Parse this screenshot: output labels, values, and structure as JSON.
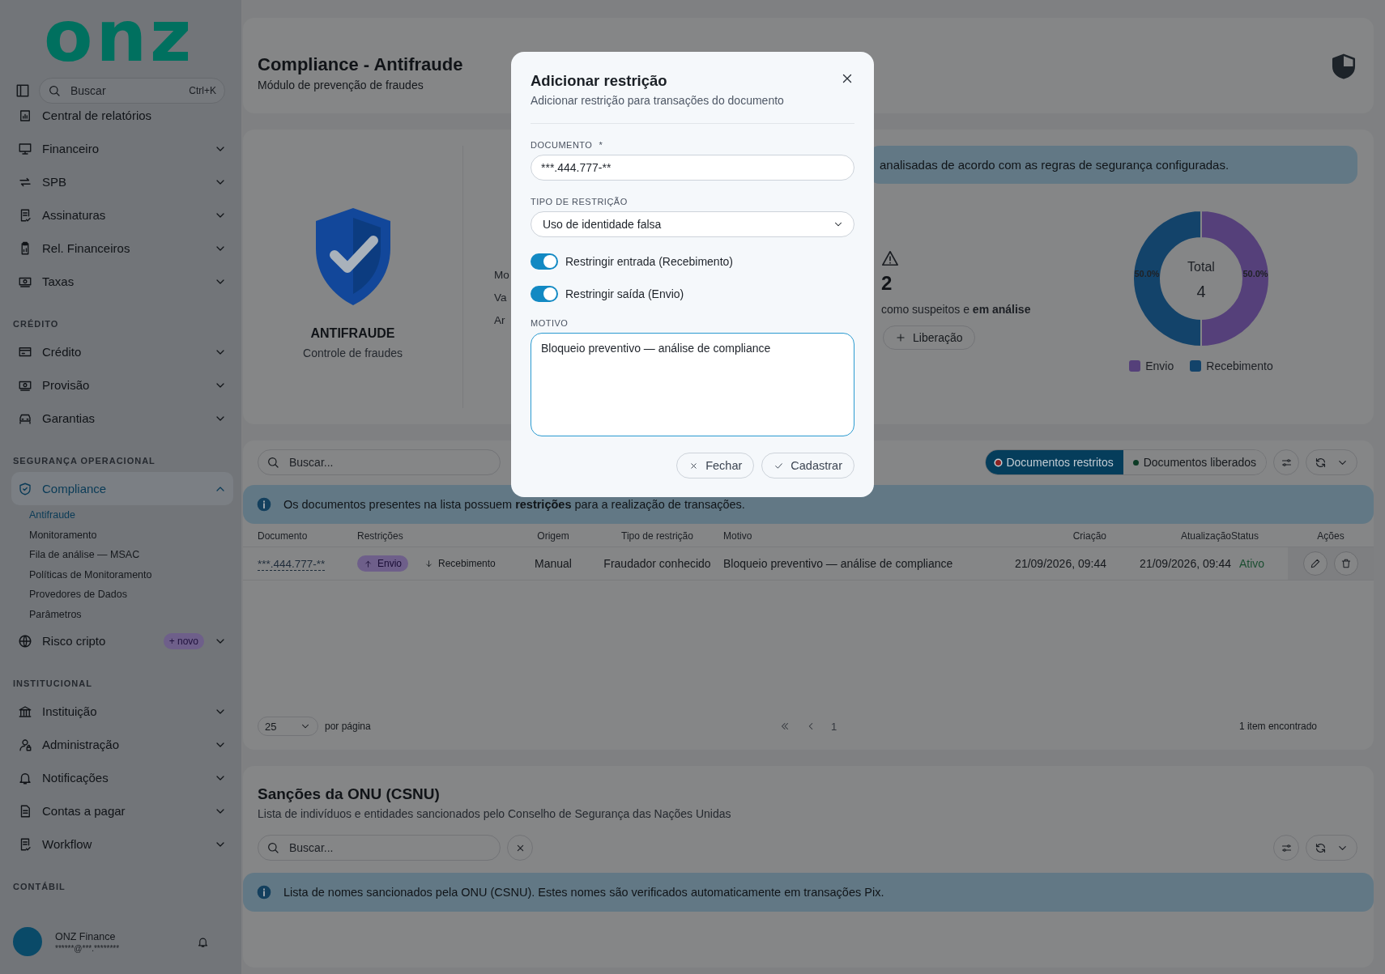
{
  "sidebar": {
    "logo": "onz",
    "search": {
      "placeholder": "Buscar",
      "shortcut": "Ctrl+K"
    },
    "groups": [
      {
        "items": [
          {
            "label": "Central de relatórios",
            "expandable": false,
            "selected": false
          },
          {
            "label": "Financeiro",
            "expandable": true,
            "expanded": false,
            "selected": false
          },
          {
            "label": "SPB",
            "expandable": true,
            "expanded": false,
            "selected": false
          },
          {
            "label": "Assinaturas",
            "expandable": true,
            "expanded": false,
            "selected": false
          },
          {
            "label": "Rel. Financeiros",
            "expandable": true,
            "expanded": false,
            "selected": false
          },
          {
            "label": "Taxas",
            "expandable": true,
            "expanded": false,
            "selected": false
          }
        ]
      },
      {
        "title": "CRÉDITO",
        "items": [
          {
            "label": "Crédito",
            "expandable": true,
            "expanded": false,
            "selected": false
          },
          {
            "label": "Provisão",
            "expandable": true,
            "expanded": false,
            "selected": false
          },
          {
            "label": "Garantias",
            "expandable": true,
            "expanded": false,
            "selected": false
          }
        ]
      },
      {
        "title": "SEGURANÇA OPERACIONAL",
        "items": [
          {
            "label": "Compliance",
            "expandable": true,
            "expanded": true,
            "selected": true,
            "children": [
              {
                "label": "Antifraude",
                "selected": true
              },
              {
                "label": "Monitoramento",
                "selected": false
              },
              {
                "label": "Fila de análise — MSAC",
                "selected": false
              },
              {
                "label": "Políticas de Monitoramento",
                "selected": false
              },
              {
                "label": "Provedores de Dados",
                "selected": false
              },
              {
                "label": "Parâmetros",
                "selected": false
              }
            ]
          },
          {
            "label": "Risco cripto",
            "expandable": true,
            "expanded": false,
            "selected": false,
            "badge": "+ novo"
          }
        ]
      },
      {
        "title": "INSTITUCIONAL",
        "items": [
          {
            "label": "Instituição",
            "expandable": true,
            "expanded": false,
            "selected": false
          },
          {
            "label": "Administração",
            "expandable": true,
            "expanded": false,
            "selected": false
          },
          {
            "label": "Notificações",
            "expandable": true,
            "expanded": false,
            "selected": false
          },
          {
            "label": "Contas a pagar",
            "expandable": true,
            "expanded": false,
            "selected": false
          },
          {
            "label": "Workflow",
            "expandable": true,
            "expanded": false,
            "selected": false
          }
        ]
      },
      {
        "title": "CONTÁBIL"
      }
    ],
    "user": {
      "name": "ONZ Finance",
      "email": "******@***.********"
    }
  },
  "header": {
    "title": "Compliance - Antifraude",
    "subtitle": "Módulo de prevenção de fraudes"
  },
  "overview": {
    "badge_title": "ANTIFRAUDE",
    "badge_subtitle": "Controle de fraudes",
    "stat_labels": [
      "Mo",
      "Va",
      "Ar"
    ],
    "notice": "analisadas de acordo com as regras de segurança configuradas.",
    "suspect_count": "2",
    "suspect_text": "como suspeitos e **em análise**",
    "release_button": "Liberação",
    "chart": {
      "center_label": "Total",
      "center_value": "4",
      "legend": [
        {
          "color": "#55407a"
        },
        {
          "color": "#13436a"
        }
      ],
      "chart_data": {
        "type": "donut",
        "categories": [
          "Envio",
          "Recebimento"
        ],
        "values": [
          50,
          50
        ],
        "value_labels": [
          "50.0%",
          "50.0%"
        ]
      }
    }
  },
  "documents": {
    "search_placeholder": "Buscar...",
    "views": [
      {
        "label": "Documentos restritos",
        "selected": true,
        "color": "#8a2323"
      },
      {
        "label": "Documentos liberados",
        "selected": false,
        "color": "#0d3b26"
      }
    ],
    "notice": "Os documentos presentes na lista possuem **restrições** para a realização de transações.",
    "columns": [
      "Documento",
      "Restrições",
      "Origem",
      "Tipo de restrição",
      "Motivo",
      "Criação",
      "Atualização",
      "Status",
      "Ações"
    ],
    "rows": [
      {
        "document": "***.444.777-**",
        "restrictions": [
          {
            "label": "Envio",
            "kind": "outgoing",
            "active": true
          },
          {
            "label": "Recebimento",
            "kind": "incoming",
            "active": false
          }
        ],
        "origin": "Manual",
        "type": "Fraudador conhecido",
        "reason": "Bloqueio preventivo — análise de compliance",
        "created": "21/09/2026, 09:44",
        "updated": "21/09/2026, 09:44",
        "status": "Ativo"
      }
    ],
    "per_page": "25",
    "per_page_label": "por página",
    "page": "1",
    "result_count": "1 item encontrado"
  },
  "sanctions": {
    "title": "Sanções da ONU (CSNU)",
    "subtitle": "Lista de indivíduos e entidades sancionados pelo Conselho de Segurança das Nações Unidas",
    "search_placeholder": "Buscar...",
    "notice": "Lista de nomes sancionados pela ONU (CSNU). Estes nomes são verificados automaticamente em transações Pix."
  },
  "dialog": {
    "title": "Adicionar restrição",
    "subtitle": "Adicionar restrição para transações do documento",
    "fields": [
      {
        "kind": "text",
        "label": "DOCUMENTO",
        "required_mark": "*",
        "value": "***.444.777-**"
      },
      {
        "kind": "select",
        "label": "TIPO DE RESTRIÇÃO",
        "value": "Uso de identidade falsa"
      },
      {
        "kind": "toggle",
        "label": "Restringir entrada (Recebimento)",
        "on": true
      },
      {
        "kind": "toggle",
        "label": "Restringir saída (Envio)",
        "on": true
      },
      {
        "kind": "textarea",
        "label": "MOTIVO",
        "value": "Bloqueio preventivo — análise de compliance"
      }
    ],
    "buttons": [
      {
        "label": "Fechar",
        "kind": "close"
      },
      {
        "label": "Cadastrar",
        "kind": "confirm"
      }
    ]
  }
}
